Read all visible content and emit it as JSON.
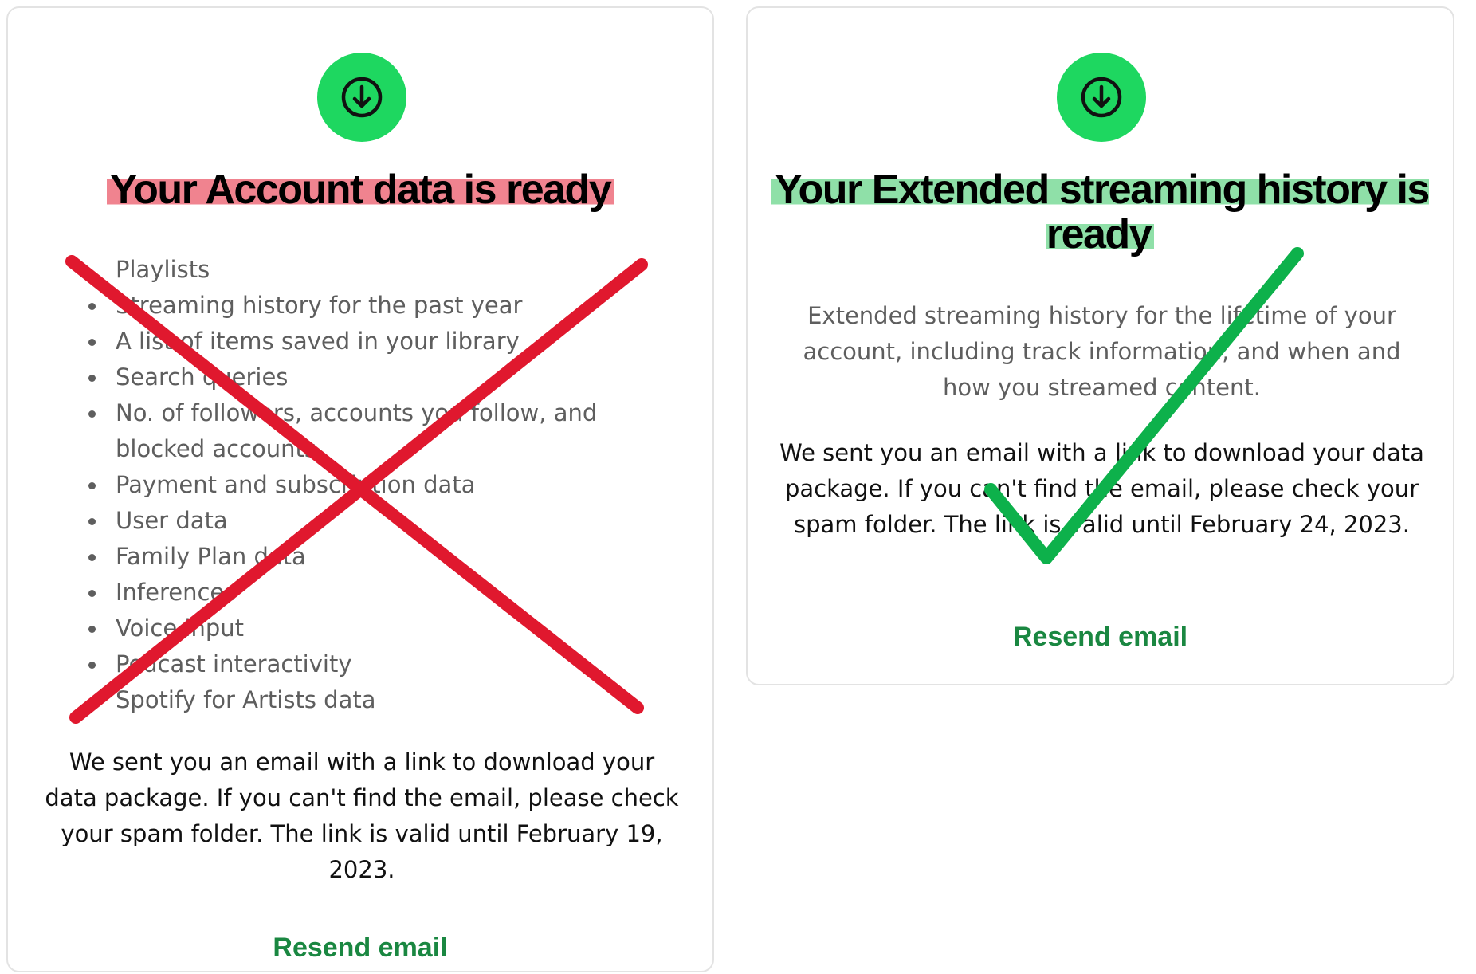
{
  "account_card": {
    "title": "Your Account data is ready",
    "items": [
      "Playlists",
      "Streaming history for the past year",
      "A list of items saved in your library",
      "Search queries",
      "No. of followers, accounts you follow, and blocked accounts",
      "Payment and subscription data",
      "User data",
      "Family Plan data",
      "Inferences",
      "Voice input",
      "Podcast interactivity",
      "Spotify for Artists data"
    ],
    "email_text": "We sent you an email with a link to download your data package. If you can't find the email, please check your spam folder. The link is valid until February 19, 2023.",
    "resend_label": "Resend email",
    "highlight_color": "#f0838f",
    "mark": "red-cross"
  },
  "extended_card": {
    "title": "Your Extended streaming history is ready",
    "description": "Extended streaming history for the lifetime of your account, including track information, and when and how you streamed content.",
    "email_text": "We sent you an email with a link to download your data package. If you can't find the email, please check your spam folder. The link is valid until February 24, 2023.",
    "resend_label": "Resend email",
    "highlight_color": "#8fe0a8",
    "mark": "green-checkmark"
  },
  "icons": {
    "download": "download-circle-icon"
  },
  "colors": {
    "spotify_green": "#1ed760",
    "link_green": "#1a8741",
    "cross_red": "#e0182e",
    "check_green": "#0db14b"
  }
}
